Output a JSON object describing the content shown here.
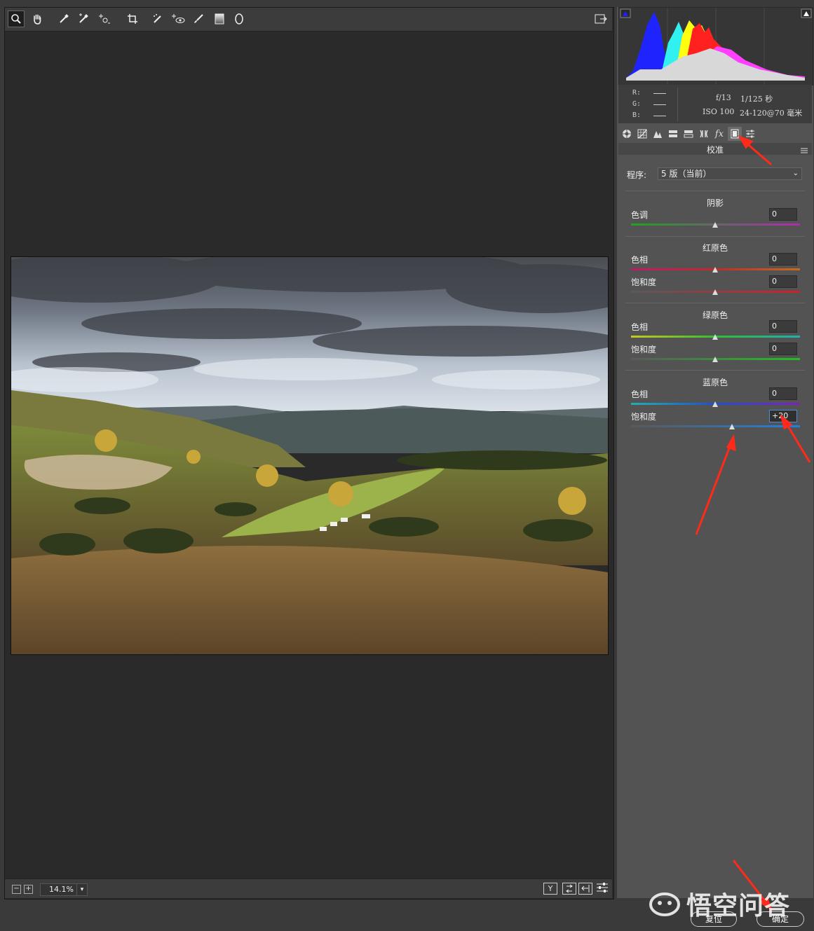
{
  "toolbar": {
    "tools": [
      "zoom-tool",
      "hand-tool",
      "white-balance-tool",
      "color-sampler-tool",
      "targeted-adjustment-tool",
      "crop-tool",
      "spot-removal-tool",
      "red-eye-tool",
      "adjustment-brush-tool",
      "graduated-filter-tool",
      "radial-filter-tool"
    ],
    "open_preferences_icon": "export-icon"
  },
  "zoom": {
    "value": "14.1%",
    "minus": "−",
    "plus": "+"
  },
  "info": {
    "r_label": "R:",
    "g_label": "G:",
    "b_label": "B:",
    "aperture": "f/13",
    "shutter": "1/125 秒",
    "iso": "ISO 100",
    "lens": "24-120@70 毫米"
  },
  "panel": {
    "section_title": "校准",
    "program_label": "程序:",
    "program_value": "5 版（当前）",
    "shadows": {
      "title": "阴影",
      "tint_label": "色调",
      "tint_value": "0"
    },
    "red_primary": {
      "title": "红原色",
      "hue_label": "色相",
      "hue_value": "0",
      "sat_label": "饱和度",
      "sat_value": "0"
    },
    "green_primary": {
      "title": "绿原色",
      "hue_label": "色相",
      "hue_value": "0",
      "sat_label": "饱和度",
      "sat_value": "0"
    },
    "blue_primary": {
      "title": "蓝原色",
      "hue_label": "色相",
      "hue_value": "0",
      "sat_label": "饱和度",
      "sat_value": "+20"
    }
  },
  "footer": {
    "reset_label": "复位",
    "ok_label": "确定"
  },
  "watermark": {
    "text": "悟空问答"
  },
  "colors": {
    "accent_focus": "#4d8ad8",
    "annotation_arrow": "#ff2a1a"
  }
}
